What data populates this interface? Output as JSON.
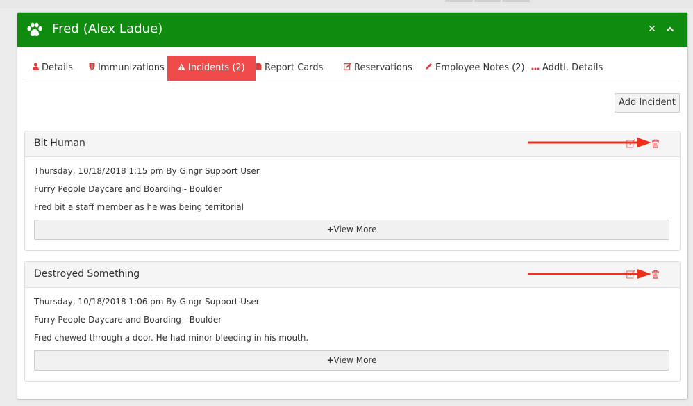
{
  "modal": {
    "title": "Fred (Alex Ladue)",
    "header_color": "#0f8c0f",
    "close_icon": "times-icon",
    "collapse_icon": "chevron-up-icon"
  },
  "tabs": [
    {
      "label": "Details",
      "icon": "user-icon"
    },
    {
      "label": "Immunizations",
      "icon": "shield-icon"
    },
    {
      "label": "Incidents (2)",
      "icon": "warning-icon",
      "active": true
    },
    {
      "label": "Report Cards",
      "icon": "file-icon"
    },
    {
      "label": "Reservations",
      "icon": "edit-icon"
    },
    {
      "label": "Employee Notes (2)",
      "icon": "pencil-icon"
    },
    {
      "label": "Addtl. Details",
      "icon": "ellipsis-icon"
    }
  ],
  "active_tab_color": "#ef4b4b",
  "add_incident_label": "Add Incident",
  "incidents": [
    {
      "title": "Bit Human",
      "meta": "Thursday, 10/18/2018 1:15 pm By Gingr Support User",
      "location": "Furry People Daycare and Boarding - Boulder",
      "description": "Fred bit a staff member as he was being territorial",
      "view_more": "View More"
    },
    {
      "title": "Destroyed Something",
      "meta": "Thursday, 10/18/2018 1:06 pm By Gingr Support User",
      "location": "Furry People Daycare and Boarding - Boulder",
      "description": "Fred chewed through a door. He had minor bleeding in his mouth.",
      "view_more": "View More"
    }
  ],
  "annotation_arrow_color": "#f0301a"
}
